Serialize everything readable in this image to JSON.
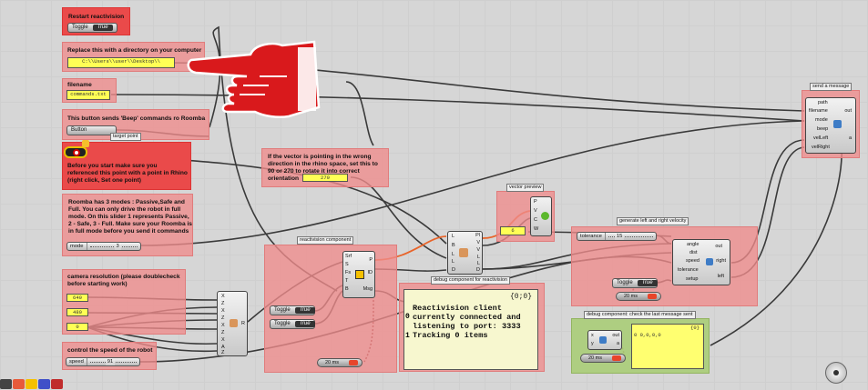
{
  "restart": {
    "title": "Restart reactivision",
    "toggle_label": "Toggle",
    "toggle_value": "True"
  },
  "directory": {
    "title": "Replace this with a directory on your computer",
    "path": "C:\\\\Users\\\\user\\\\Desktop\\\\"
  },
  "filename": {
    "title": "filename",
    "value": "commands.txt"
  },
  "beep": {
    "title": "This button sends 'Beep' commands ro Roomba",
    "button_label": "Button",
    "target_tag": "target point"
  },
  "point_warning": "Before you start make sure you referenced this point with a point in Rhino (right click, Set one point)",
  "vector_note": {
    "text": "If the vector is pointing in the wrong direction in the rhino space, set this to 90 or 270 to rotate it into correct orientation",
    "value": "270"
  },
  "mode_note": {
    "text": "Roomba has 3 modes : Passive,Safe and Full. You can only drive the robot in full mode. On this slider 1 represents Passive, 2 - Safe, 3 - Full. Make sure your Roomba is in full mode before you send it commands",
    "slider_label": "mode",
    "slider_value": "3"
  },
  "camera": {
    "title": "camera resolution (please doublecheck before starting work)",
    "values": [
      "640",
      "480",
      "0"
    ]
  },
  "speed": {
    "title": "control the speed of the robot",
    "slider_label": "speed",
    "slider_value": "91"
  },
  "reactivision": {
    "title": "reactivision component",
    "inputs": [
      "Srf",
      "S",
      "Fs",
      "T",
      "B"
    ],
    "outputs": [
      "P",
      "ID",
      "Msg"
    ],
    "toggle_label": "Toggle",
    "toggle_value": "True",
    "toggle2_label": "Toggle",
    "toggle2_value": "True",
    "timer": "20 ms"
  },
  "xyz_component": {
    "inputs": [
      "X",
      "Z",
      "X",
      "Z",
      "X",
      "Z",
      "X",
      "A",
      "Z"
    ],
    "output": "R"
  },
  "pl_component": {
    "inputs": [
      "L",
      "B",
      "L",
      "L",
      "D"
    ],
    "outputs": [
      "Pl",
      "V",
      "V",
      "L",
      "L",
      "D"
    ]
  },
  "vector_preview": {
    "title": "vector preview",
    "inputs": [
      "P",
      "V",
      "C",
      "W"
    ],
    "value": "6"
  },
  "debug_reactivision": {
    "title": "debug component for reactivision",
    "header": "{0;0}",
    "lines": [
      "Reactivision client",
      "currently connected and",
      "listening to port: 3333",
      "Tracking 0 items"
    ],
    "indices": [
      "0",
      "1"
    ]
  },
  "velocity": {
    "title": "generate left and right velocity",
    "tolerance_label": "tolerance",
    "tolerance_value": "15",
    "inputs": [
      "angle",
      "dist",
      "speed",
      "tolerance",
      "setup"
    ],
    "outputs": [
      "out",
      "right",
      "left"
    ],
    "toggle_label": "Toggle",
    "toggle_value": "True",
    "timer": "20 ms"
  },
  "send_message": {
    "title": "send a message",
    "inputs": [
      "path",
      "filename",
      "mode",
      "beep",
      "velLeft",
      "velRight"
    ],
    "outputs": [
      "out",
      "a"
    ]
  },
  "debug_last": {
    "title": "debug component: check the last message sent",
    "header": "{0}",
    "row_index": "0",
    "row_value": "0,0,0,0",
    "inputs": [
      "x",
      "y"
    ],
    "outputs": [
      "out",
      "a"
    ],
    "timer": "20 ms"
  },
  "colors": {
    "group_red": "#ea4a4a",
    "group_pink": "#f08c8c",
    "group_green": "#aacd78",
    "panel_yellow": "#ffff55",
    "wire": "#3a3a3a",
    "wire_orange": "#e8642a"
  }
}
